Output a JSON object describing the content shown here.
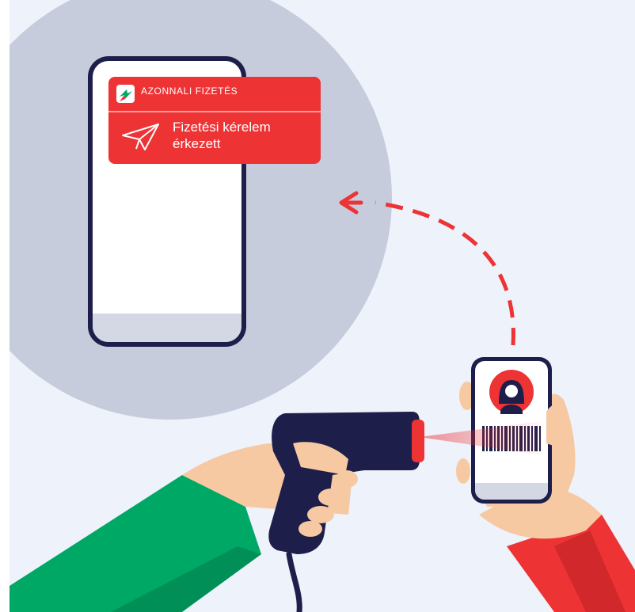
{
  "notification": {
    "app_label": "AZONNALI FIZETÉS",
    "message": "Fizetési kérelem érkezett",
    "icon": "paper-plane-icon",
    "logo": "azonnali-fizetes-logo"
  },
  "colors": {
    "background": "#eef2fb",
    "circle": "#c6ccdc",
    "accent_red": "#ee3335",
    "navy": "#1e1e4b",
    "green_sleeve": "#00a865",
    "skin": "#f6c9a2"
  }
}
